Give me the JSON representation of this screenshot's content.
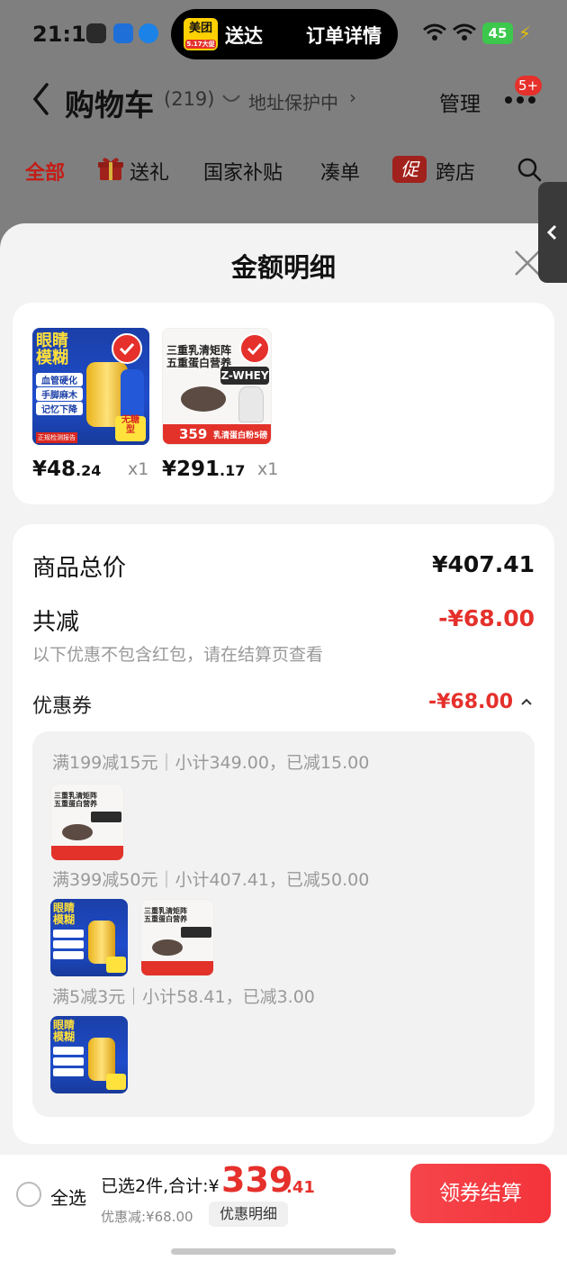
{
  "status_bar": {
    "time": "21:17",
    "island_app": "美团",
    "island_app_sub": "5.17大促",
    "island_send": "送达",
    "island_order": "订单详情",
    "battery": "45"
  },
  "header": {
    "title": "购物车",
    "count": "(219)",
    "address": "地址保护中",
    "manage": "管理",
    "badge": "5+"
  },
  "tabs": [
    "全部",
    "送礼",
    "国家补贴",
    "凑单",
    "跨店"
  ],
  "tab_icons": {
    "promo": "促"
  },
  "sheet": {
    "title": "金额明细",
    "products": [
      {
        "price_int": "¥48",
        "price_dec": ".24",
        "qty": "x1",
        "thumb": {
          "title": "眼睛\n模糊",
          "tags": [
            "血管硬化",
            "手脚麻木",
            "记忆下降"
          ],
          "badge": "无糖\n型",
          "footer": "正规检测报告"
        }
      },
      {
        "price_int": "¥291",
        "price_dec": ".17",
        "qty": "x1",
        "thumb": {
          "title": "三重乳清矩阵\n五重蛋白营养",
          "brand": "Z-WHEY",
          "price": "359",
          "footer": "乳清蛋白粉5磅"
        }
      }
    ],
    "total_label": "商品总价",
    "total_value": "¥407.41",
    "reduce_label": "共减",
    "reduce_value": "-¥68.00",
    "note": "以下优惠不包含红包，请在结算页查看",
    "coupon_label": "优惠券",
    "coupon_value": "-¥68.00",
    "rules": [
      "满199减15元｜小计349.00，已减15.00",
      "满399减50元｜小计407.41，已减50.00",
      "满5减3元｜小计58.41，已减3.00"
    ]
  },
  "bottom": {
    "select_all": "全选",
    "summary": "已选2件,合计:¥",
    "total_int": "339",
    "total_dec": ".41",
    "discount": "优惠减:¥68.00",
    "detail": "优惠明细",
    "checkout": "领券结算"
  },
  "colors": {
    "accent": "#e5302b",
    "sheet_bg": "#f3f3f3",
    "overlay": "#7f7f7f"
  }
}
